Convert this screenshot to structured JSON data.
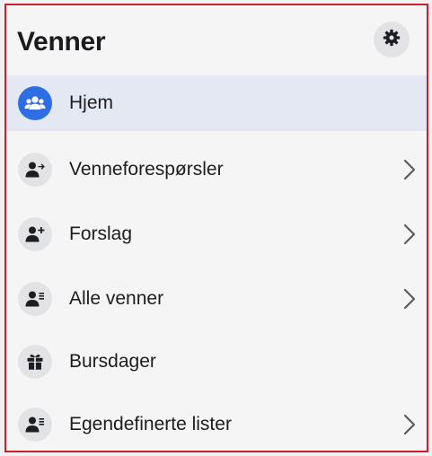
{
  "header": {
    "title": "Venner",
    "settings_icon": "gear-icon"
  },
  "menu": [
    {
      "label": "Hjem",
      "icon": "friends-icon",
      "active": true,
      "chevron": false
    },
    {
      "label": "Venneforespørsler",
      "icon": "friend-request-icon",
      "active": false,
      "chevron": true
    },
    {
      "label": "Forslag",
      "icon": "add-friend-icon",
      "active": false,
      "chevron": true
    },
    {
      "label": "Alle venner",
      "icon": "friend-list-icon",
      "active": false,
      "chevron": true
    },
    {
      "label": "Bursdager",
      "icon": "gift-icon",
      "active": false,
      "chevron": false
    },
    {
      "label": "Egendefinerte lister",
      "icon": "friend-list-icon",
      "active": false,
      "chevron": true
    }
  ],
  "colors": {
    "accent": "#2f6ee2",
    "active_background": "#e4e8f3",
    "icon_background": "#e3e3e6",
    "frame_border": "#c8202c"
  }
}
